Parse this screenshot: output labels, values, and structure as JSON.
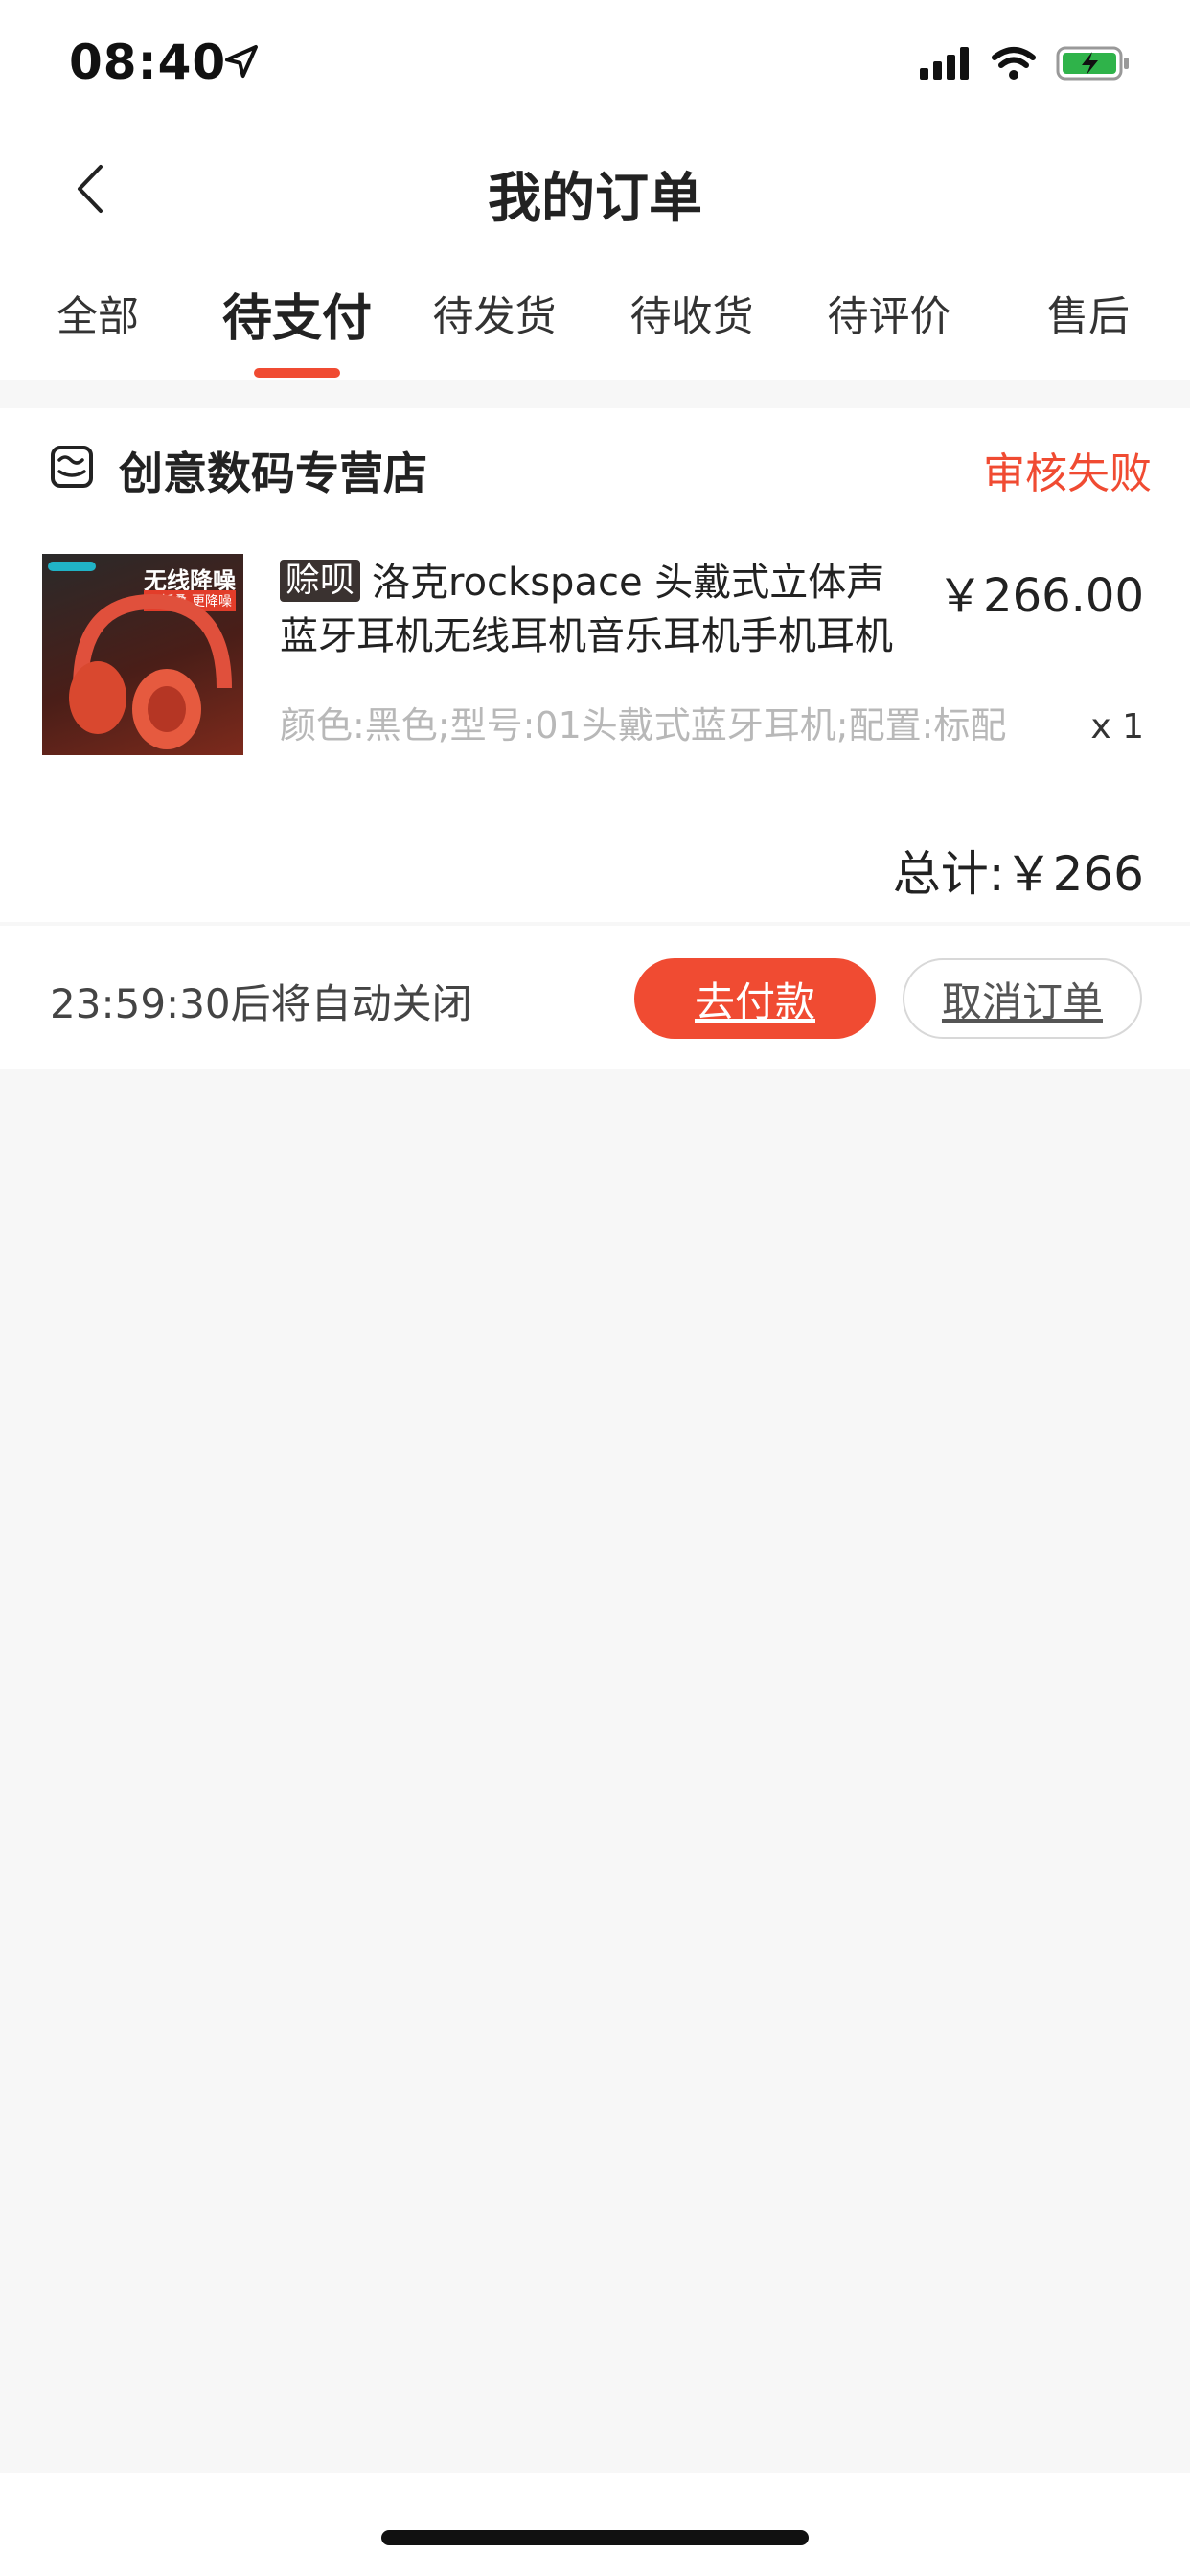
{
  "status_bar": {
    "time": "08:40"
  },
  "nav": {
    "title": "我的订单"
  },
  "tabs": [
    {
      "label": "全部"
    },
    {
      "label": "待支付"
    },
    {
      "label": "待发货"
    },
    {
      "label": "待收货"
    },
    {
      "label": "待评价"
    },
    {
      "label": "售后"
    }
  ],
  "order": {
    "store_name": "创意数码专营店",
    "status": "审核失败",
    "product": {
      "badge": "赊呗",
      "title": "洛克rockspace 头戴式立体声蓝牙耳机无线耳机音乐耳机手机耳机",
      "price": "￥266.00",
      "spec": "颜色:黑色;型号:01头戴式蓝牙耳机;配置:标配",
      "quantity": "x 1",
      "thumb_headline": "无线降噪",
      "thumb_sub": "可折叠 更降噪"
    },
    "total": "总计:￥266",
    "countdown": "23:59:30后将自动关闭",
    "pay_label": "去付款",
    "cancel_label": "取消订单"
  },
  "colors": {
    "accent": "#f04b32",
    "background": "#f7f7f7"
  }
}
